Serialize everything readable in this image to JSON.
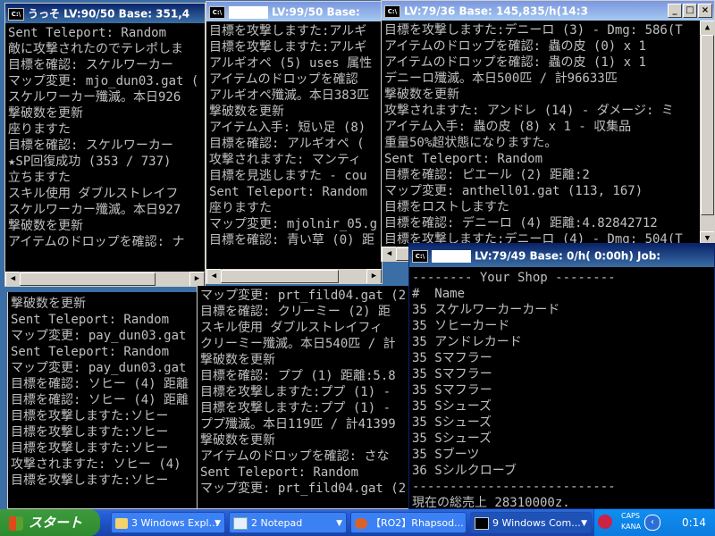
{
  "windows": {
    "w1": {
      "title": "うっそ  LV:90/50  Base:  351,4",
      "lines": [
        "Sent Teleport: Random",
        "敵に攻撃されたのでテレポしま",
        "目標を確認: スケルワーカー",
        "マップ変更: mjo_dun03.gat (",
        "スケルワーカー殲滅。本日926",
        "撃破数を更新",
        "座りますた",
        "目標を確認: スケルワーカー",
        "★SP回復成功 (353 / 737)",
        "立ちますた",
        "スキル使用 ダブルストレイフ",
        "スケルワーカー殲滅。本日927",
        "撃破数を更新",
        "アイテムのドロップを確認: ナ"
      ]
    },
    "w2": {
      "title": "LV:99/50  Base:",
      "lines": [
        "目標を攻撃しますた:アルギ",
        "目標を攻撃しますた:アルギ",
        "アルギオペ (5) uses 属性",
        "アイテムのドロップを確認",
        "アルギオペ殲滅。本日383匹",
        "撃破数を更新",
        "アイテム入手: 短い足 (8)",
        "目標を確認: アルギオペ (",
        "攻撃されますた: マンティ",
        "目標を見逃しますた - cou",
        "Sent Teleport: Random",
        "座りますた",
        "マップ変更: mjolnir_05.g",
        "目標を確認: 青い草 (0) 距"
      ]
    },
    "w3": {
      "title": "LV:79/36  Base:  145,835/h(14:3",
      "lines": [
        "目標を攻撃しますた:デニーロ (3) - Dmg: 586(T",
        "アイテムのドロップを確認: 蟲の皮 (0) x 1",
        "アイテムのドロップを確認: 蟲の皮 (1) x 1",
        "デニーロ殲滅。本日500匹 / 計96633匹",
        "撃破数を更新",
        "攻撃されますた: アンドレ (14) - ダメージ: ミ",
        "アイテム入手: 蟲の皮 (8) x 1 - 収集品",
        "重量50%超状態になりますた。",
        "Sent Teleport: Random",
        "目標を確認: ピエール (2) 距離:2",
        "マップ変更: anthell01.gat (113, 167)",
        "目標をロストしますた",
        "目標を確認: デニーロ (4) 距離:4.82842712",
        "目標を攻撃しますた:デニーロ (4) - Dmg: 504(T"
      ]
    },
    "w4": {
      "lines": [
        "撃破数を更新",
        "Sent Teleport: Random",
        "マップ変更: pay_dun03.gat",
        "Sent Teleport: Random",
        "マップ変更: pay_dun03.gat",
        "目標を確認: ソヒー (4) 距離",
        "目標を確認: ソヒー (4) 距離",
        "目標を攻撃しますた:ソヒー",
        "目標を攻撃しますた:ソヒー",
        "目標を攻撃しますた:ソヒー",
        "攻撃されますた: ソヒー (4)",
        "目標を攻撃しますた:ソヒー"
      ]
    },
    "w5": {
      "lines": [
        "マップ変更: prt_fild04.gat (2",
        "目標を確認: クリーミー (2) 距",
        "スキル使用 ダブルストレイフィ",
        "クリーミー殲滅。本日540匹 / 計",
        "撃破数を更新",
        "目標を確認: ププ (1) 距離:5.8",
        "目標を攻撃しますた:ププ (1) -",
        "目標を攻撃しますた:ププ (1) -",
        "ププ殲滅。本日119匹 / 計41399",
        "撃破数を更新",
        "アイテムのドロップを確認: さな",
        "Sent Teleport: Random",
        "マップ変更: prt_fild04.gat (2"
      ]
    },
    "w6": {
      "title": "LV:79/49  Base:        0/h(  0:00h)  Job:",
      "lines": [
        "-------- Your Shop --------",
        "#  Name",
        "35 スケルワーカーカード",
        "35 ソヒーカード",
        "35 アンドレカード",
        "35 Sマフラー",
        "35 Sマフラー",
        "35 Sマフラー",
        "35 Sシューズ",
        "35 Sシューズ",
        "35 Sシューズ",
        "35 Sブーツ",
        "36 Sシルクローブ",
        "---------------------------",
        "現在の総売上 28310000z."
      ]
    }
  },
  "taskbar": {
    "start": "スタート",
    "tasks": [
      {
        "label": "3 Windows Expl...",
        "icon": "folder-icon"
      },
      {
        "label": "2 Notepad",
        "icon": "notepad-icon"
      },
      {
        "label": "【RO2】Rhapsod...",
        "icon": "browser-icon"
      },
      {
        "label": "9 Windows Com...",
        "icon": "console-icon"
      }
    ],
    "tray": {
      "caps": "CAPS",
      "kana": "KANA",
      "time": "0:14"
    }
  }
}
